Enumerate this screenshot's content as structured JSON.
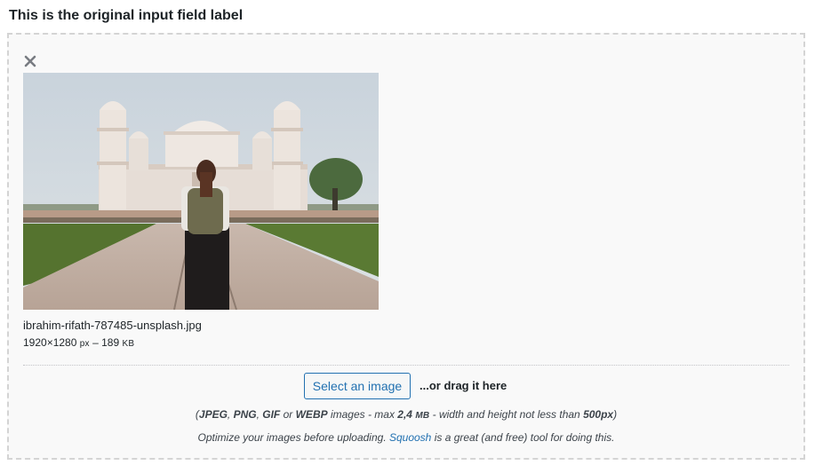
{
  "field": {
    "label": "This is the original input field label"
  },
  "icons": {
    "remove": "close-icon",
    "preview": "photo-taj-mahal-woman-backpack"
  },
  "colors": {
    "accent": "#2271b1",
    "dropzone_bg": "#f9f9f9",
    "dropzone_border": "#d4d4d4",
    "text": "#1d2327"
  },
  "upload": {
    "file_name": "ibrahim-rifath-787485-unsplash.jpg",
    "dimensions": "1920×1280",
    "dim_unit": "px",
    "dash": "–",
    "size_value": "189",
    "size_unit": "KB",
    "select_label": "Select an image",
    "drag_text": "...or drag it here",
    "formats": {
      "open": "(",
      "f1": "JPEG",
      "sep1": ", ",
      "f2": "PNG",
      "sep2": ", ",
      "f3": "GIF",
      "or": " or ",
      "f4": "WEBP",
      "mid": " images - max ",
      "max_value": "2,4",
      "max_unit": "MB",
      "tail": " - width and height not less than ",
      "min_px": "500px",
      "close": ")"
    },
    "optimize": {
      "before": "Optimize your images before uploading. ",
      "link": "Squoosh",
      "after": " is a great (and free) tool for doing this."
    }
  }
}
